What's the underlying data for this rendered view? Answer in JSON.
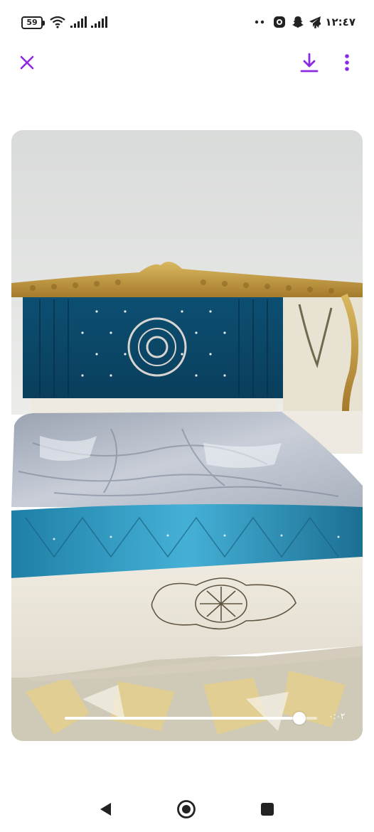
{
  "status_bar": {
    "battery": "59",
    "time": "١٢:٤٧ م",
    "icons": [
      "wifi-icon",
      "signal-icon",
      "signal-icon-2",
      "dots-icon",
      "chat-app-icon",
      "snapchat-icon",
      "telegram-icon"
    ]
  },
  "app_bar": {
    "close_icon": "close-icon",
    "download_icon": "download-icon",
    "more_icon": "more-vertical-icon",
    "accent_color": "#8a2be2"
  },
  "video": {
    "elapsed": "٠:٠٢",
    "progress": 0.93,
    "state": "playing",
    "pause_icon": "pause-icon"
  },
  "nav_bar": {
    "back_icon": "back-icon",
    "home_icon": "home-icon",
    "recents_icon": "recents-icon"
  }
}
